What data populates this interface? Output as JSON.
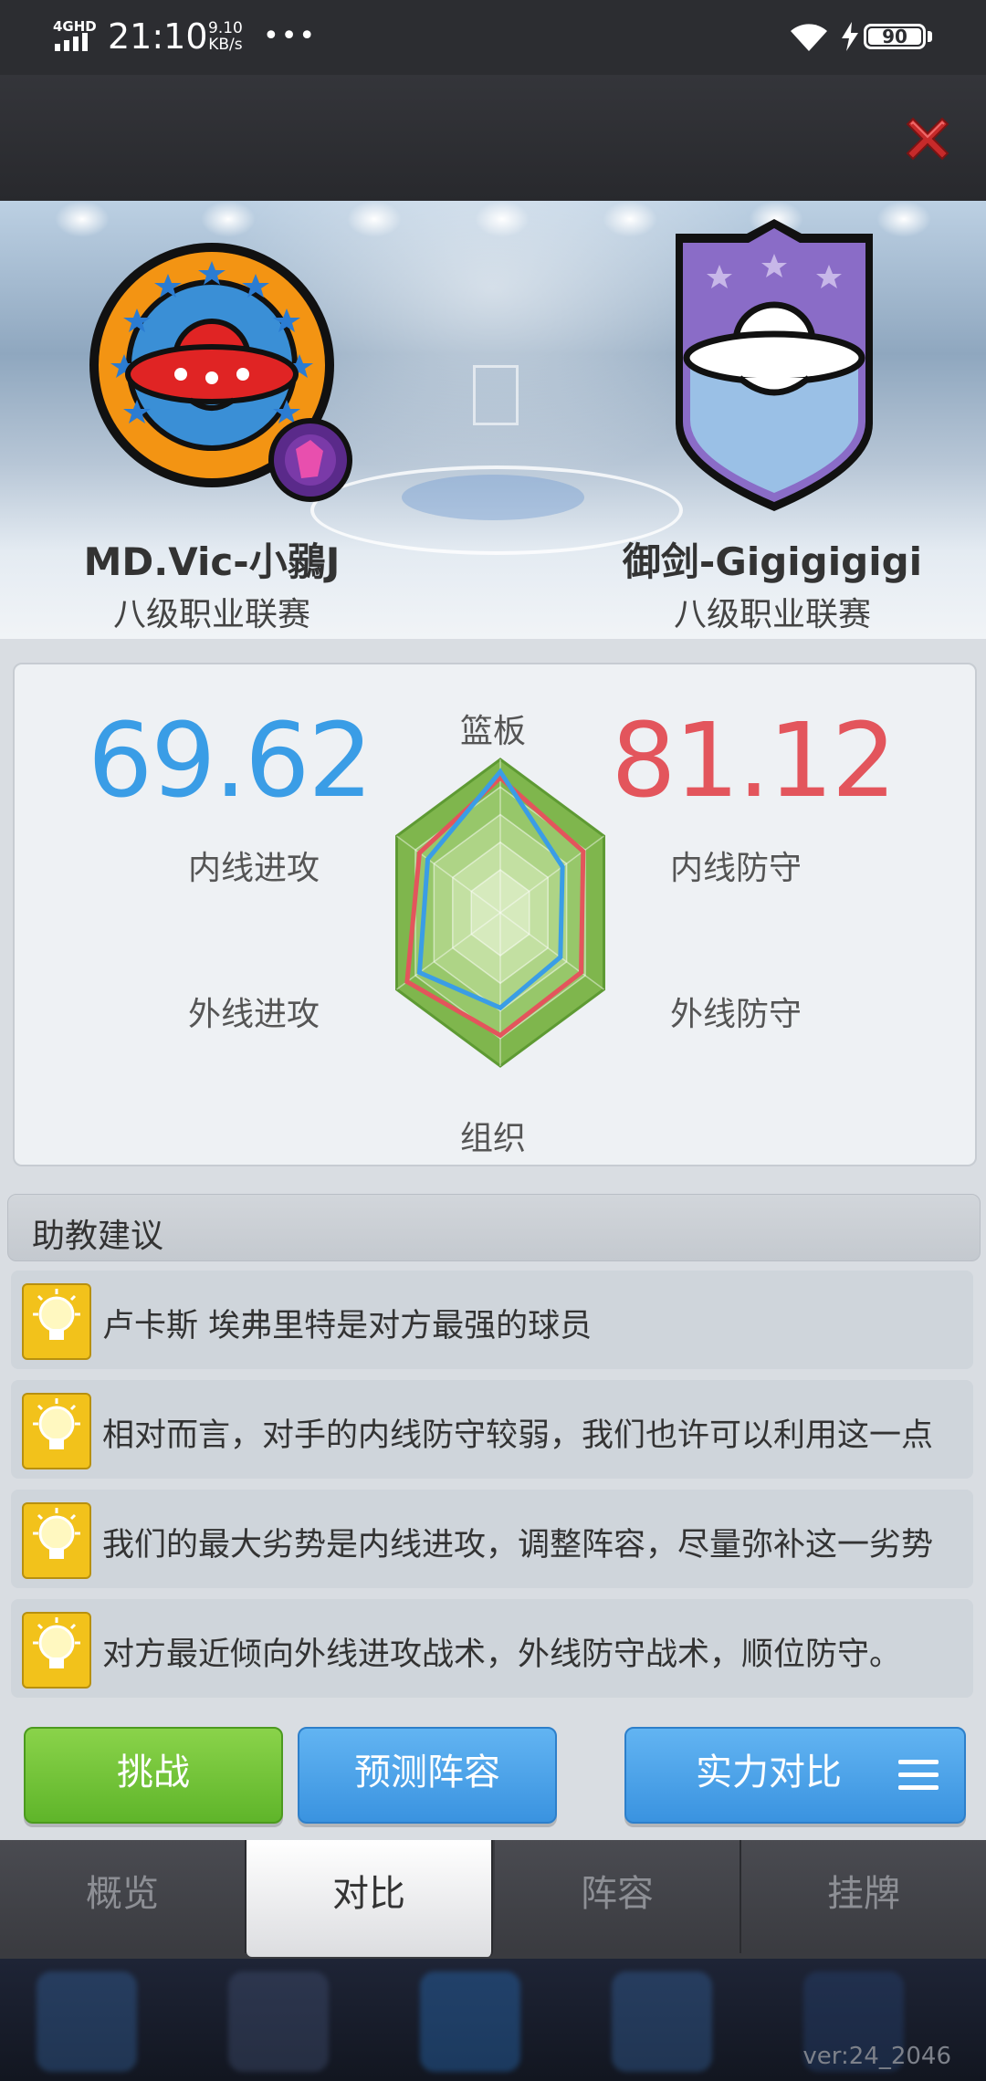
{
  "status_bar": {
    "network": "4GHD",
    "time": "21:10",
    "speed_value": "9.10",
    "speed_unit": "KB/s",
    "more": "•••",
    "battery": "90"
  },
  "home_team": {
    "name": "MD.Vic-小鶸J",
    "league": "八级职业联赛"
  },
  "away_team": {
    "name": "御剑-Gigigigigi",
    "league": "八级职业联赛"
  },
  "comparison": {
    "home_score": "69.62",
    "away_score": "81.12",
    "labels": {
      "rebound": "篮板",
      "inside_attack": "内线进攻",
      "outside_attack": "外线进攻",
      "inside_defense": "内线防守",
      "outside_defense": "外线防守",
      "organize": "组织"
    },
    "colors": {
      "home": "#3a9de6",
      "away": "#e3555c",
      "radar_fill": "#7fbf4a"
    },
    "home_values": [
      0.92,
      0.6,
      0.58,
      0.62,
      0.78,
      0.7
    ],
    "away_values": [
      0.88,
      0.8,
      0.78,
      0.8,
      0.9,
      0.78
    ]
  },
  "advice": {
    "header": "助教建议",
    "items": [
      "卢卡斯 埃弗里特是对方最强的球员",
      "相对而言，对手的内线防守较弱，我们也许可以利用这一点",
      "我们的最大劣势是内线进攻，调整阵容，尽量弥补这一劣势",
      "对方最近倾向外线进攻战术，外线防守战术，顺位防守。"
    ]
  },
  "buttons": {
    "challenge": "挑战",
    "predict_lineup": "预测阵容",
    "strength_compare": "实力对比"
  },
  "tabs": [
    "概览",
    "对比",
    "阵容",
    "挂牌"
  ],
  "active_tab": "对比",
  "version": "ver:24_2046"
}
